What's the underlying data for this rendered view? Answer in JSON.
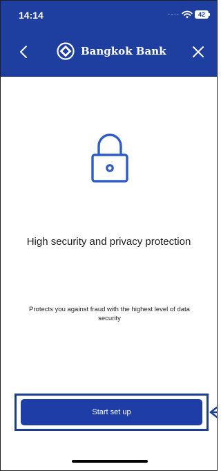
{
  "status_bar": {
    "time": "14:14",
    "signal_dots": "....",
    "battery": "42"
  },
  "header": {
    "brand_name": "Bangkok Bank",
    "back_icon": "chevron-left-icon",
    "close_icon": "close-icon",
    "logo_icon": "bangkok-bank-logo"
  },
  "content": {
    "icon": "lock-icon",
    "title": "High security and privacy protection",
    "description": "Protects you against fraud with the highest level of data security"
  },
  "actions": {
    "start_label": "Start set up"
  },
  "colors": {
    "header_bg": "#1e3fa0",
    "button_bg": "#1e3da6",
    "accent": "#2f5cc4",
    "highlight": "#1c3e95"
  }
}
